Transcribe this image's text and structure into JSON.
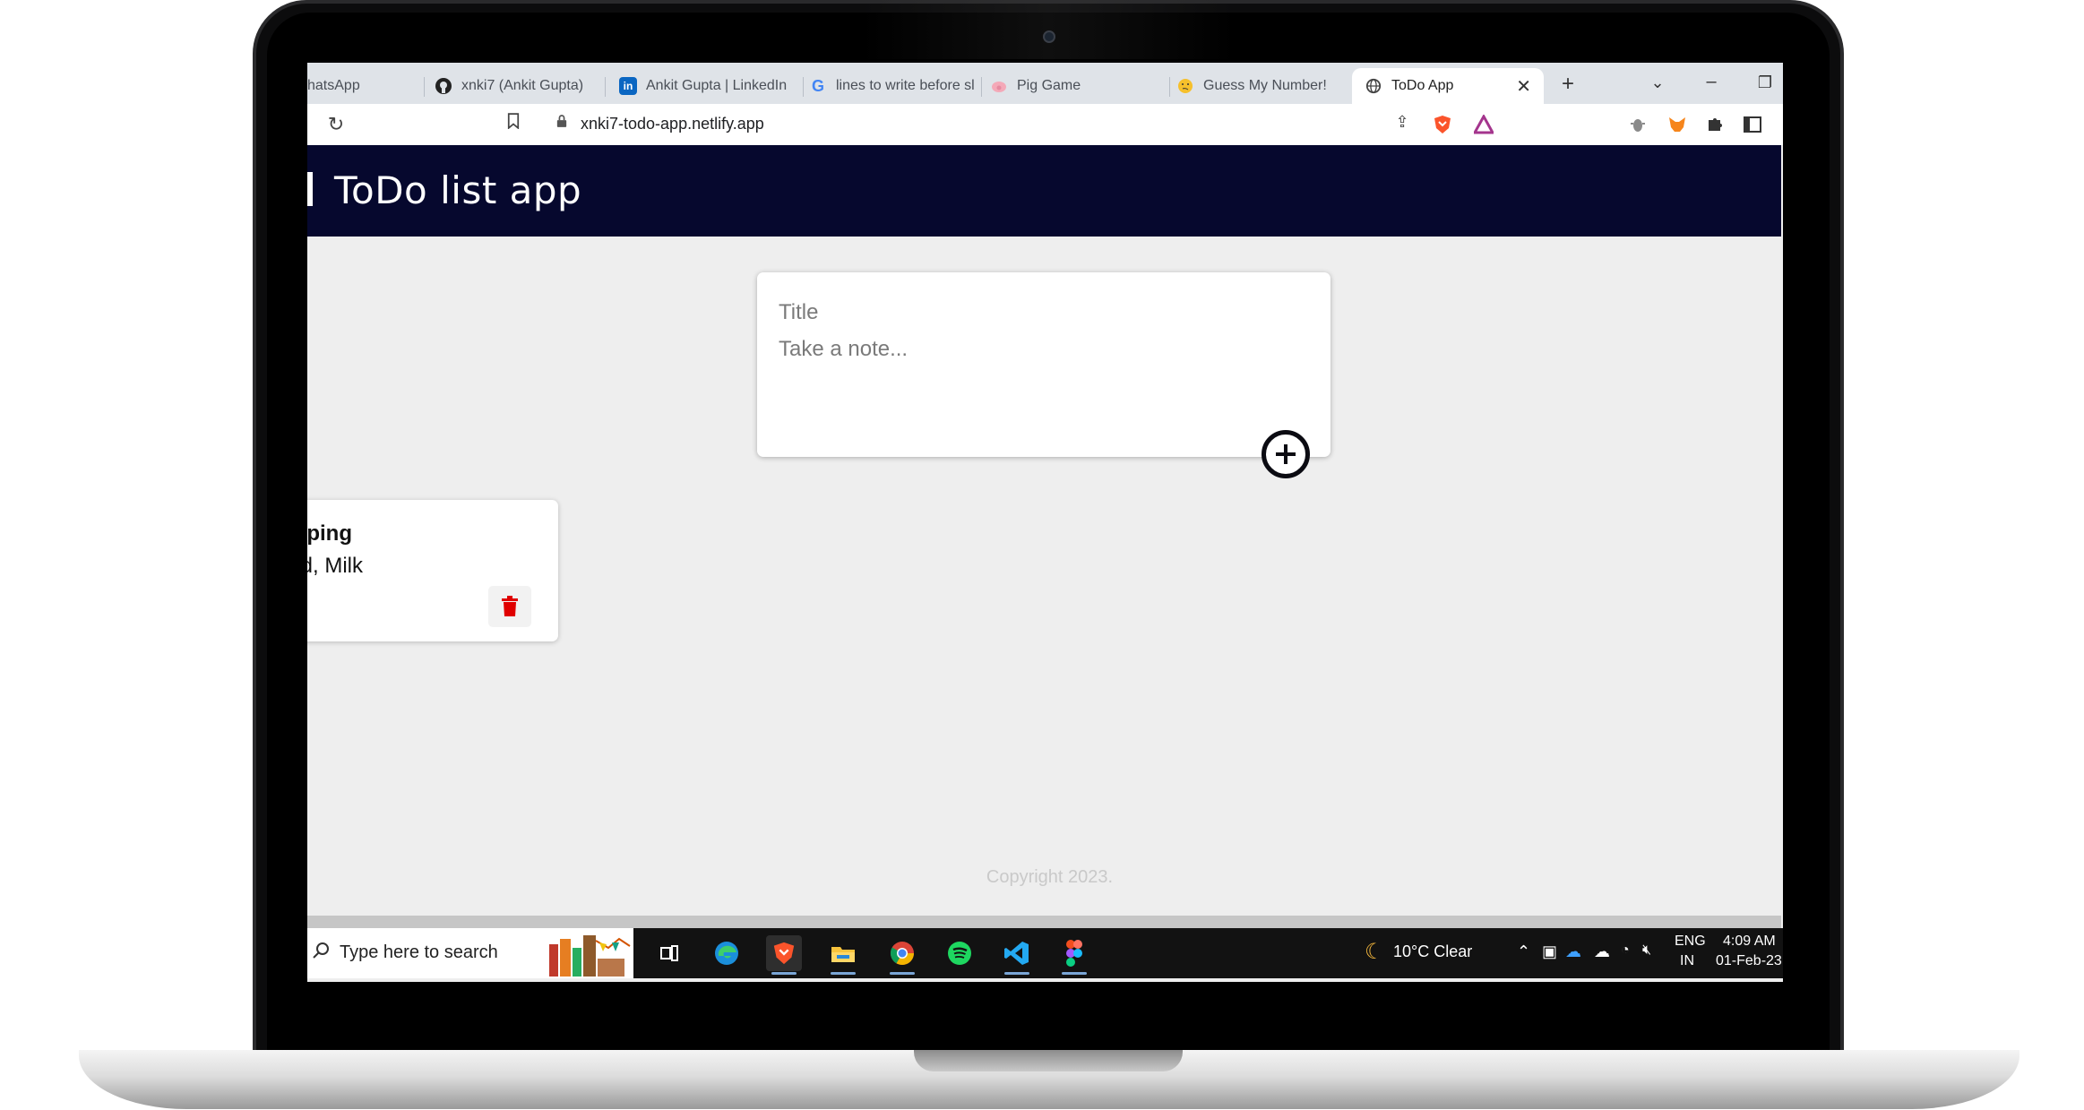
{
  "browser": {
    "tabs": [
      {
        "label": "hatsApp",
        "icon": "whatsapp-icon"
      },
      {
        "label": "xnki7 (Ankit Gupta)",
        "icon": "github-icon"
      },
      {
        "label": "Ankit Gupta | LinkedIn",
        "icon": "linkedin-icon"
      },
      {
        "label": "lines to write before sl",
        "icon": "google-icon"
      },
      {
        "label": "Pig Game",
        "icon": "pig-icon"
      },
      {
        "label": "Guess My Number!",
        "icon": "thinking-emoji-icon"
      },
      {
        "label": "ToDo App",
        "icon": "globe-icon",
        "active": true
      }
    ],
    "new_tab": "+",
    "url": "xnki7-todo-app.netlify.app"
  },
  "app": {
    "title": "ToDo list app",
    "form": {
      "title_placeholder": "Title",
      "note_placeholder": "Take a note..."
    },
    "notes": [
      {
        "title": "Shopping",
        "content": "Bread, Milk"
      }
    ],
    "footer": "Copyright 2023."
  },
  "taskbar": {
    "search_placeholder": "Type here to search",
    "weather": "10°C  Clear",
    "lang_top": "ENG",
    "lang_bottom": "IN",
    "time": "4:09 AM",
    "date": "01-Feb-23"
  },
  "colors": {
    "header_bg": "#06082e",
    "delete_icon": "#e00000",
    "page_bg": "#eeeeee"
  }
}
